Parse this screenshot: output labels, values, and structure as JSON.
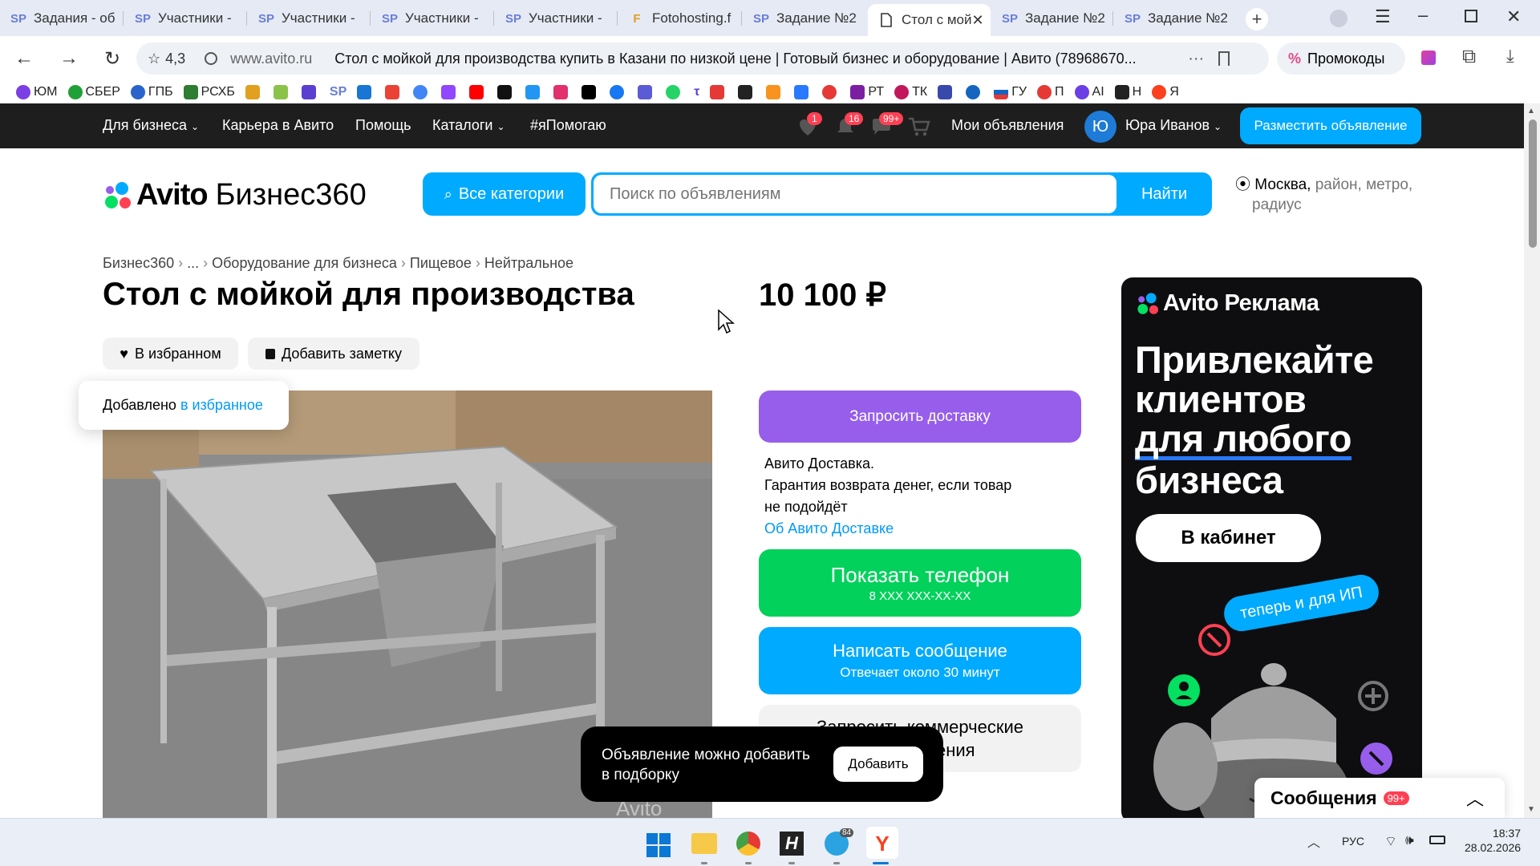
{
  "browser": {
    "tabs": [
      {
        "icon": "SP",
        "label": "Задания - об"
      },
      {
        "icon": "SP",
        "label": "Участники - "
      },
      {
        "icon": "SP",
        "label": "Участники - "
      },
      {
        "icon": "SP",
        "label": "Участники - "
      },
      {
        "icon": "SP",
        "label": "Участники - "
      },
      {
        "icon": "F",
        "label": "Fotohosting.f"
      },
      {
        "icon": "SP",
        "label": "Задание №2"
      },
      {
        "icon": "page",
        "label": "Стол с мой"
      },
      {
        "icon": "SP",
        "label": "Задание №2"
      },
      {
        "icon": "SP",
        "label": "Задание №2"
      }
    ],
    "rating": "4,3",
    "domain": "www.avito.ru",
    "page_title": "Стол с мойкой для производства купить в Казани по низкой цене | Готовый бизнес и оборудование | Авито (78968670...",
    "promo_label": "Промокоды",
    "bookmarks": [
      "ЮМ",
      "СБЕР",
      "ГПБ",
      "РСХБ",
      "",
      "",
      "",
      "SP",
      "",
      "",
      "",
      "",
      "",
      "",
      "",
      "",
      "",
      "",
      "",
      "",
      "",
      "",
      "",
      "",
      "",
      "РТ",
      "ТК",
      "",
      "",
      "ГУ",
      "П",
      "AI",
      "Н",
      "Я"
    ]
  },
  "site_nav": {
    "for_business": "Для бизнеса",
    "career": "Карьера в Авито",
    "help": "Помощь",
    "catalogs": "Каталоги",
    "ipomogayu": "#яПомогаю",
    "fav_badge": "1",
    "notif_badge": "16",
    "msg_badge": "99+",
    "my_ads": "Мои объявления",
    "avatar_letter": "Ю",
    "user_name": "Юра Иванов",
    "post_ad": "Разместить объявление"
  },
  "header": {
    "logo_text": "Avito",
    "logo_suffix": "Бизнес360",
    "all_categories": "Все категории",
    "search_placeholder": "Поиск по объявлениям",
    "search_button": "Найти",
    "location_city": "Москва,",
    "location_rest": "район, метро,",
    "location_rest2": "радиус"
  },
  "breadcrumbs": [
    "Бизнес360",
    "...",
    "Оборудование для бизнеса",
    "Пищевое",
    "Нейтральное"
  ],
  "listing": {
    "title": "Стол с мойкой для производства",
    "price": "10 100 ₽",
    "fav_button": "В избранном",
    "note_button": "Добавить заметку",
    "toast_text": "Добавлено ",
    "toast_link": "в избранное",
    "request_delivery": "Запросить доставку",
    "delivery_line1": "Авито Доставка.",
    "delivery_line2": "Гарантия возврата денег, если товар",
    "delivery_line3": "не подойдёт",
    "delivery_link": "Об Авито Доставке",
    "show_phone": "Показать телефон",
    "phone_masked": "8 XXX XXX-XX-XX",
    "write_message": "Написать сообщение",
    "reply_time": "Отвечает около 30 минут",
    "commercial_offer": "Запросить коммерческие предложения",
    "watermark": "Avito"
  },
  "ad_banner": {
    "logo": "Avito Реклама",
    "headline1": "Привлекайте",
    "headline2": "клиентов",
    "headline3": "для любого",
    "headline4": "бизнеса",
    "cta": "В кабинет",
    "tag": "теперь и для ИП"
  },
  "compare_popup": {
    "text": "Объявление можно добавить в подборку",
    "button": "Добавить"
  },
  "messages_widget": {
    "label": "Сообщения",
    "badge": "99+"
  },
  "taskbar": {
    "telegram_badge": "84",
    "lang": "РУС",
    "time": "18:37",
    "date": "28.02.2026"
  },
  "colors": {
    "avito_blue": "#00aaff",
    "delivery_purple": "#965eeb",
    "phone_green": "#02d15c",
    "nav_dark": "#1e1e1e",
    "badge_red": "#ff4053"
  }
}
